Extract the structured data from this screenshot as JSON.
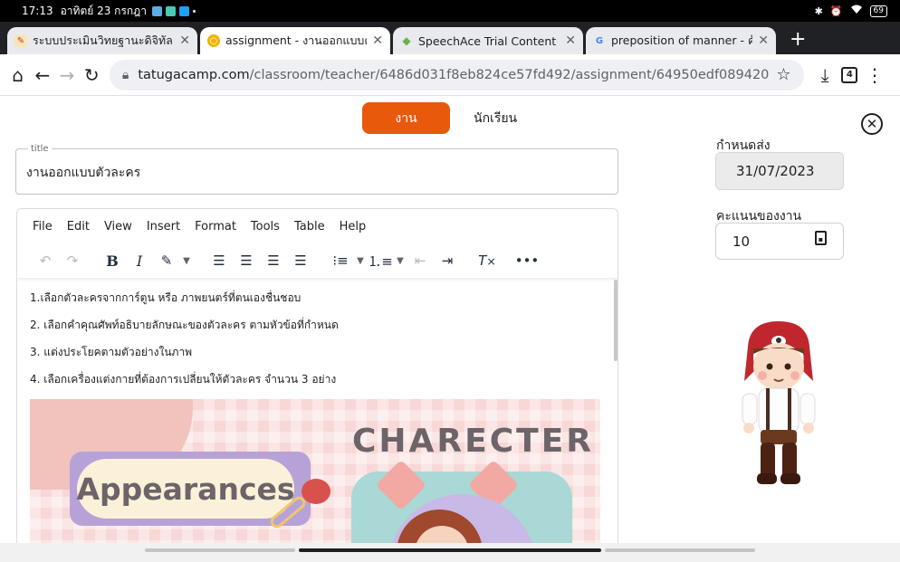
{
  "status": {
    "time": "17:13",
    "date": "อาทิตย์ 23 กรกฎา",
    "battery": "69",
    "notification_colors": [
      "#5dade2",
      "#5dade2",
      "#1da1f2"
    ]
  },
  "tabs": [
    {
      "label": "ระบบประเมินวิทยฐานะดิจิทัล(D",
      "active": false,
      "favicon_color": "#f2b134"
    },
    {
      "label": "assignment - งานออกแบบตัวล",
      "active": true,
      "favicon_color": "#f0b400"
    },
    {
      "label": "SpeechAce Trial Content",
      "active": false,
      "favicon_color": "#6ab04c"
    },
    {
      "label": "preposition of manner - ค้นห",
      "active": false,
      "favicon_color": "#4285f4",
      "favicon_text": "G"
    }
  ],
  "toolbar": {
    "url_host": "tatugacamp.com",
    "url_path": "/classroom/teacher/6486d031f8eb824ce57fd492/assignment/64950edf089420",
    "tab_count": "4"
  },
  "page": {
    "segment_active": "งาน",
    "segment_inactive": "นักเรียน",
    "title_legend": "title",
    "title_value": "งานออกแบบตัวละคร",
    "due_label": "กำหนดส่ง",
    "due_value": "31/07/2023",
    "score_label": "คะแนนของงาน",
    "score_value": "10"
  },
  "editor": {
    "menu": [
      "File",
      "Edit",
      "View",
      "Insert",
      "Format",
      "Tools",
      "Table",
      "Help"
    ],
    "lines": [
      "1.เลือกตัวละครจากการ์ตูน หรือ ภาพยนตร์ที่ตนเองชื่นชอบ",
      "2. เลือกคำคุณศัพท์อธิบายลักษณะของตัวละคร ตามหัวข้อที่กำหนด",
      "3. แต่งประโยคตามตัวอย่างในภาพ",
      "4. เลือกเครื่องแต่งกายที่ต้องการเปลี่ยนให้ตัวละคร จำนวน 3 อย่าง"
    ],
    "image_text_left": "Appearances",
    "image_text_right": "CHARECTER"
  },
  "colors": {
    "accent": "#e8590c"
  }
}
